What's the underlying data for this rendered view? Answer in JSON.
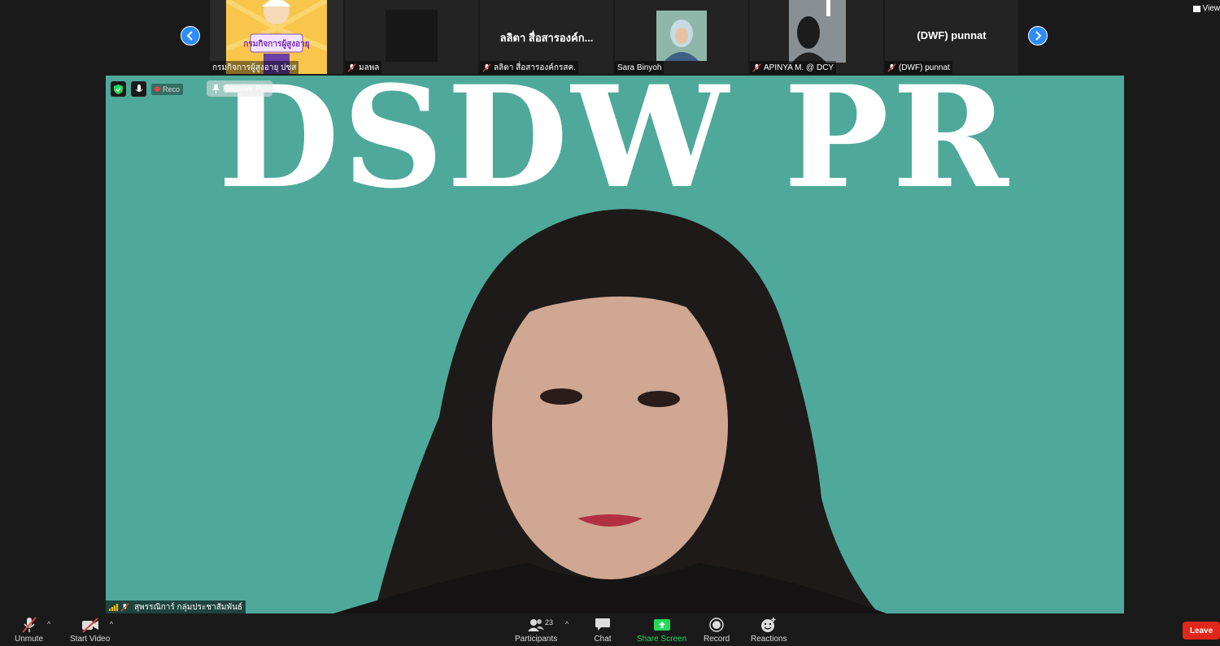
{
  "strip": {
    "tiles": [
      {
        "name": "กรมกิจการผู้สูงอายุ ปชส",
        "image_text": "กรมกิจการผู้สูงอายุ",
        "muted": false
      },
      {
        "name": "มลพล",
        "muted": true
      },
      {
        "name": "ลลิตา สื่อสารองค์กรสค.",
        "center": "ลลิตา สื่อสารองค์ก...",
        "muted": true
      },
      {
        "name": "Sara Binyoh",
        "muted": false
      },
      {
        "name": "APINYA  M. @  DCY",
        "muted": true
      },
      {
        "name": "(DWF) punnat",
        "center": "(DWF) punnat",
        "muted": true
      }
    ],
    "view_label": "View"
  },
  "main": {
    "banner": "DSDW PR",
    "recording_label": "Reco",
    "remove_pin_label": "Remove Pin",
    "speaker_name": "สุพรรณิการ์ กลุ่มประชาสัมพันธ์"
  },
  "toolbar": {
    "unmute": "Unmute",
    "start_video": "Start Video",
    "participants": "Participants",
    "participants_count": "23",
    "chat": "Chat",
    "share_screen": "Share Screen",
    "record": "Record",
    "reactions": "Reactions",
    "leave": "Leave"
  },
  "colors": {
    "accent_blue": "#2d8cff",
    "share_green": "#23d959",
    "leave_red": "#e0281a",
    "video_bg": "#4fa99a"
  }
}
